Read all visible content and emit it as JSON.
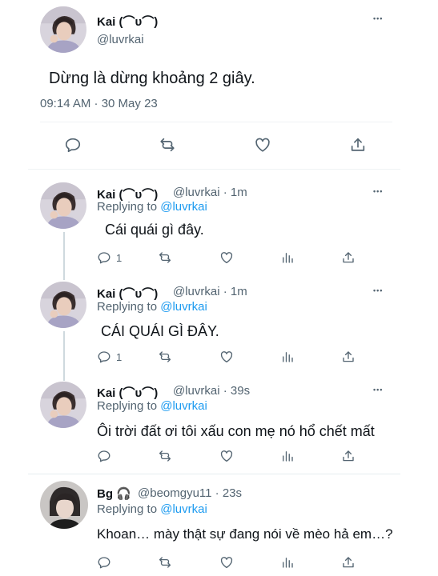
{
  "main_tweet": {
    "name": "Kai (⌒ᴜ⌒)",
    "handle": "@luvrkai",
    "text": "Dừng là dừng khoảng 2 giây.",
    "timestamp": "09:14 AM · 30 May 23",
    "more": "•••"
  },
  "replies": [
    {
      "name": "Kai (⌒ᴜ⌒)",
      "handle_meta": "@luvrkai · 1m",
      "replying_label": "Replying to ",
      "replying_to": "@luvrkai",
      "text": "Cái quái gì đây.",
      "reply_count": "1",
      "more": "•••"
    },
    {
      "name": "Kai (⌒ᴜ⌒)",
      "handle_meta": "@luvrkai · 1m",
      "replying_label": "Replying to ",
      "replying_to": "@luvrkai",
      "text": "CÁI QUÁI GÌ ĐÂY.",
      "reply_count": "1",
      "more": "•••"
    },
    {
      "name": "Kai (⌒ᴜ⌒)",
      "handle_meta": "@luvrkai · 39s",
      "replying_label": "Replying to ",
      "replying_to": "@luvrkai",
      "text": "Ôi trời đất ơi tôi xấu con mẹ nó hổ chết mất",
      "reply_count": "",
      "more": "•••"
    },
    {
      "name": "Bg 🎧",
      "handle_meta": "@beomgyu11 · 23s",
      "replying_label": "Replying to ",
      "replying_to": "@luvrkai",
      "text": "Khoan… mày thật sự đang nói về mèo hả em…?",
      "reply_count": "",
      "more": ""
    }
  ],
  "icons": [
    "reply-icon",
    "retweet-icon",
    "like-icon",
    "analytics-icon",
    "share-icon",
    "more-icon"
  ],
  "colors": {
    "link": "#1d9bf0",
    "secondary_text": "#536471",
    "divider": "#eff3f4",
    "thread_line": "#cfd9de"
  }
}
